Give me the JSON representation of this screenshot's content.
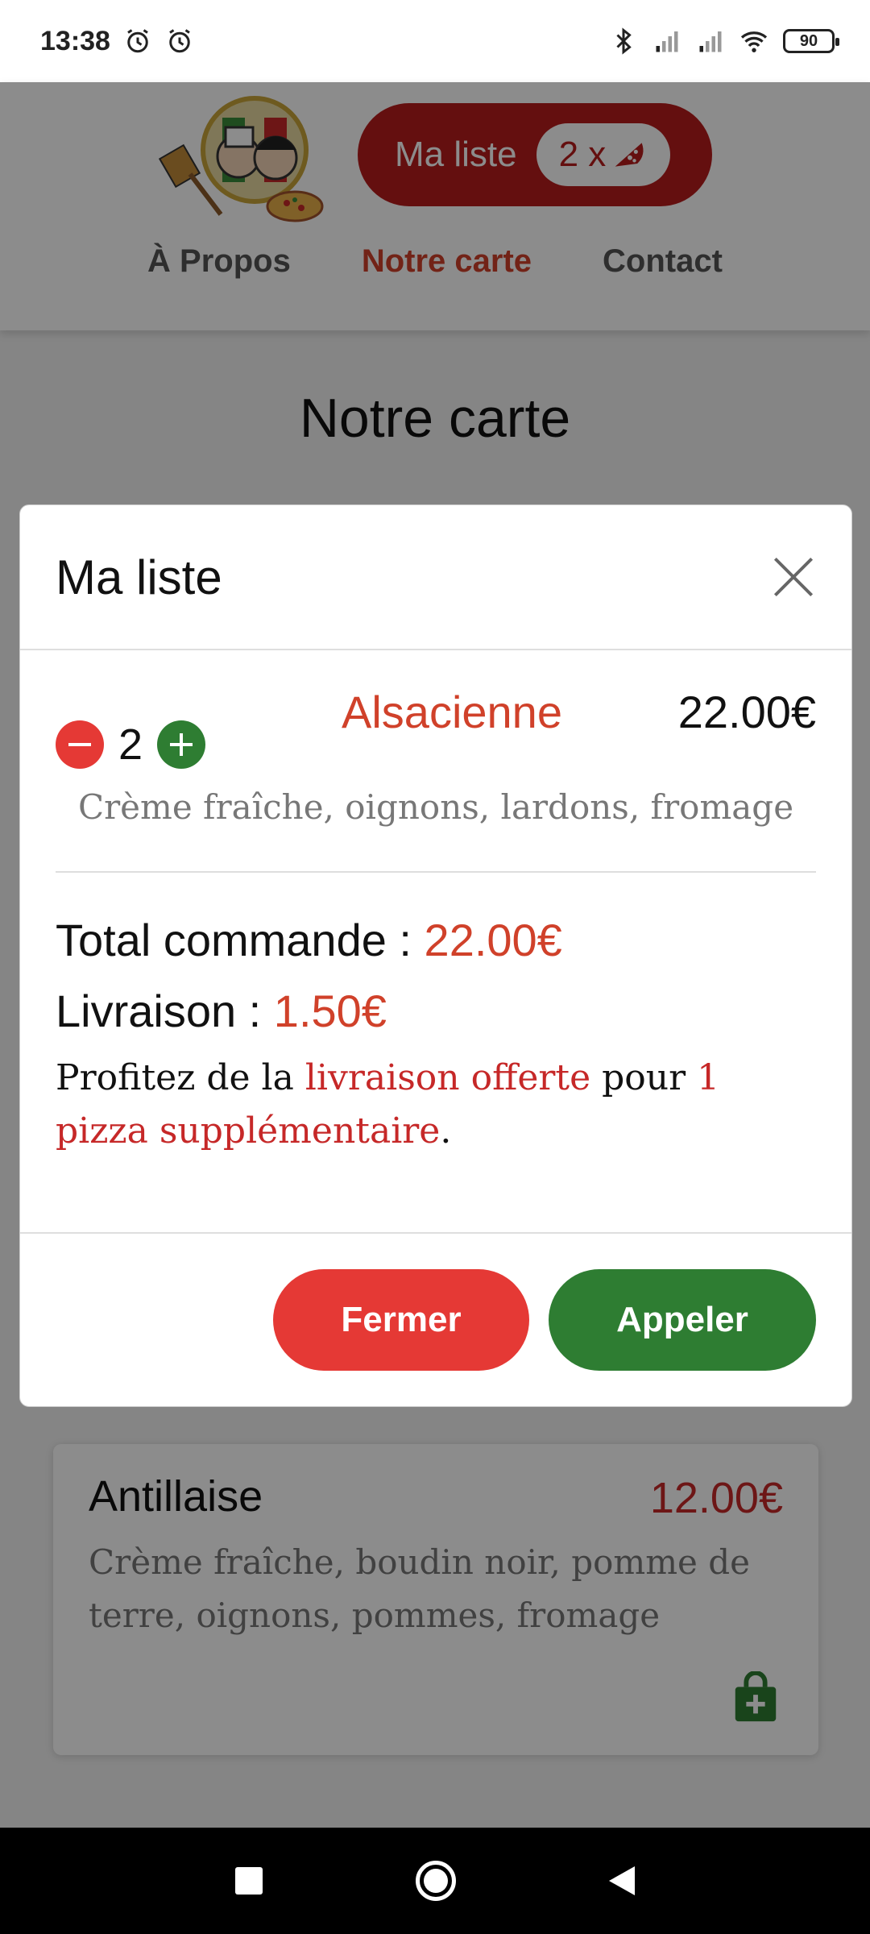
{
  "status_bar": {
    "time": "13:38",
    "battery": "90"
  },
  "header": {
    "list_button_label": "Ma liste",
    "list_badge_count": "2 x",
    "nav": [
      "À Propos",
      "Notre carte",
      "Contact"
    ],
    "active_nav": "Notre carte"
  },
  "page_title": "Notre carte",
  "modal": {
    "title": "Ma liste",
    "item": {
      "quantity": "2",
      "name": "Alsacienne",
      "price": "22.00€",
      "description": "Crème fraîche, oignons, lardons, fromage"
    },
    "total_label": "Total commande :",
    "total_value": "22.00€",
    "delivery_label": "Livraison :",
    "delivery_value": "1.50€",
    "promo": {
      "part1": "Profitez de la ",
      "highlight1": "livraison offerte",
      "part2": " pour ",
      "highlight2": "1 pizza supplémentaire",
      "part3": "."
    },
    "close_label": "Fermer",
    "call_label": "Appeler"
  },
  "menu_card": {
    "name": "Antillaise",
    "price": "12.00€",
    "description": "Crème fraîche, boudin noir, pomme de terre, oignons, pommes, fromage"
  },
  "colors": {
    "primary_red": "#b71c1c",
    "accent_red": "#d0412a",
    "button_red": "#e53935",
    "button_green": "#2e7d32"
  }
}
